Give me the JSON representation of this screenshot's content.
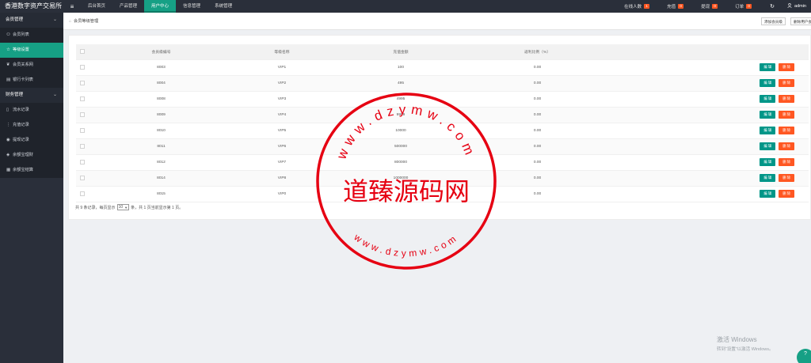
{
  "topbar": {
    "brand": "香港数字资产交易所",
    "menu_icon": "hamburger-icon",
    "nav": [
      "后台首页",
      "产品管理",
      "用户中心",
      "信息管理",
      "系统管理"
    ],
    "right": [
      {
        "label": "在线人数",
        "badge": "1"
      },
      {
        "label": "充值",
        "badge": "0"
      },
      {
        "label": "提现",
        "badge": "0"
      },
      {
        "label": "订单",
        "badge": "0"
      }
    ],
    "admin": "admin"
  },
  "sidebar": {
    "group1": "会员管理",
    "items1": [
      "会员列表",
      "等级设置",
      "会员关系网",
      "银行卡列表"
    ],
    "group2": "财务管理",
    "items2": [
      "流水记录",
      "充值记录",
      "提现记录",
      "余额宝理财",
      "余额宝结算"
    ]
  },
  "tabbar": {
    "breadcrumb": "会员等级管理",
    "add_button": "添加会员级",
    "delete_button": "删除用户会"
  },
  "table": {
    "headers": [
      "会员级编号",
      "等级名称",
      "充值金额",
      "返利比例（%）"
    ],
    "rows": [
      {
        "id": "8003",
        "name": "VIP1",
        "amount": "100",
        "rate": "0.00"
      },
      {
        "id": "8004",
        "name": "VIP2",
        "amount": "495",
        "rate": "0.00"
      },
      {
        "id": "8008",
        "name": "VIP3",
        "amount": "4995",
        "rate": "0.00"
      },
      {
        "id": "8009",
        "name": "VIP4",
        "amount": "9999",
        "rate": "0.00"
      },
      {
        "id": "8010",
        "name": "VIP5",
        "amount": "10000",
        "rate": "0.00"
      },
      {
        "id": "8011",
        "name": "VIP6",
        "amount": "500000",
        "rate": "0.00"
      },
      {
        "id": "8012",
        "name": "VIP7",
        "amount": "800000",
        "rate": "0.00"
      },
      {
        "id": "8014",
        "name": "VIP8",
        "amount": "1000000",
        "rate": "0.00"
      },
      {
        "id": "8015",
        "name": "VIP0",
        "amount": "",
        "rate": "0.00"
      }
    ],
    "edit_label": "编 辑",
    "delete_label": "删 除"
  },
  "pager": {
    "prefix": "共 9 条记录，每页显示",
    "page_size": "10",
    "suffix": "条，共 1 页当前显示第 1 页。"
  },
  "watermark": {
    "center": "道臻源码网",
    "ring_top": "www.dzymw.com",
    "ring_bottom": "www.dzymw.com",
    "stamp_color": "#e60012"
  },
  "windows_notice": {
    "line1": "激活 Windows",
    "line2": "转到“设置”以激活 Windows。"
  },
  "colors": {
    "accent": "#16a085",
    "danger": "#ff5722",
    "dark": "#2a2f3a"
  }
}
